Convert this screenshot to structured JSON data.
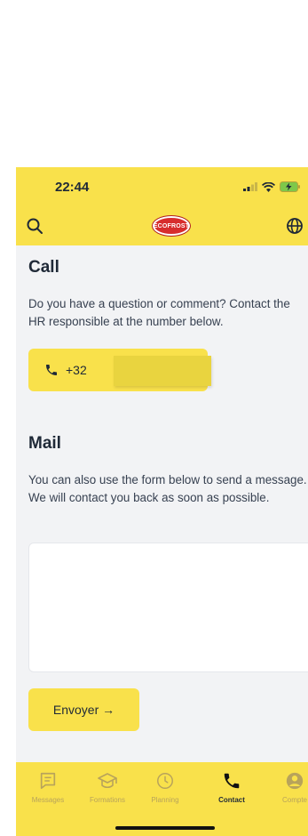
{
  "status": {
    "time": "22:44"
  },
  "header": {
    "logo_text": "ECOFROST",
    "search_icon": "search-icon",
    "globe_icon": "globe-icon"
  },
  "call": {
    "title": "Call",
    "description": "Do you have a question or comment? Contact the HR responsible at the number below.",
    "phone_prefix": "+32"
  },
  "mail": {
    "title": "Mail",
    "description": "You can also use the form below to send a message. We will contact you back as soon as possible.",
    "message_value": "",
    "send_label": "Envoyer →"
  },
  "tabs": [
    {
      "label": "Messages",
      "icon": "message-icon",
      "active": false
    },
    {
      "label": "Formations",
      "icon": "graduation-cap-icon",
      "active": false
    },
    {
      "label": "Planning",
      "icon": "clock-icon",
      "active": false
    },
    {
      "label": "Contact",
      "icon": "phone-icon",
      "active": true
    },
    {
      "label": "Compte",
      "icon": "user-icon",
      "active": false
    }
  ],
  "colors": {
    "accent": "#f9e14b",
    "inactive_tab": "#b8a35b",
    "text": "#1f2937",
    "background": "#f2f3f5"
  }
}
